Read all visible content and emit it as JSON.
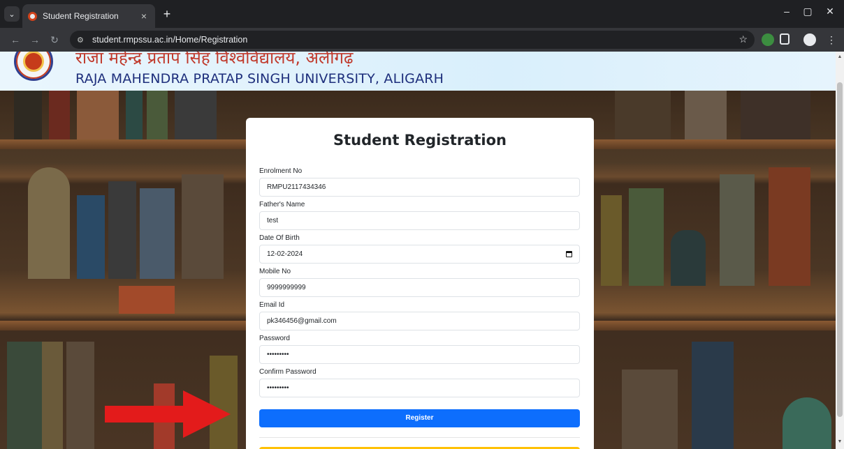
{
  "browser": {
    "tab_title": "Student Registration",
    "tab_close": "×",
    "new_tab": "+",
    "url": "student.rmpssu.ac.in/Home/Registration",
    "minimize": "–",
    "restore": "▢",
    "close": "✕"
  },
  "header": {
    "hindi_name": "राजा महेन्द्र प्रताप सिंह विश्वविद्यालय, अलीगढ़",
    "english_name": "RAJA MAHENDRA PRATAP SINGH UNIVERSITY, ALIGARH"
  },
  "form": {
    "title": "Student Registration",
    "fields": [
      {
        "label": "Enrolment No",
        "value": "RMPU2117434346"
      },
      {
        "label": "Father's Name",
        "value": "test"
      },
      {
        "label": "Date Of Birth",
        "value": "12-02-2024"
      },
      {
        "label": "Mobile No",
        "value": "9999999999"
      },
      {
        "label": "Email Id",
        "value": "pk346456@gmail.com"
      },
      {
        "label": "Password",
        "value": "•••••••••"
      },
      {
        "label": "Confirm Password",
        "value": "•••••••••"
      }
    ],
    "register_label": "Register"
  },
  "colors": {
    "primary_button": "#0d6efd",
    "secondary_button": "#ffc107",
    "arrow": "#e31b1b",
    "hindi_text": "#c0392b",
    "english_text": "#1e2f7c"
  },
  "icons": [
    "site-info-icon",
    "star-icon",
    "extension-icon",
    "profile-icon",
    "calendar-icon",
    "arrow-annotation"
  ]
}
